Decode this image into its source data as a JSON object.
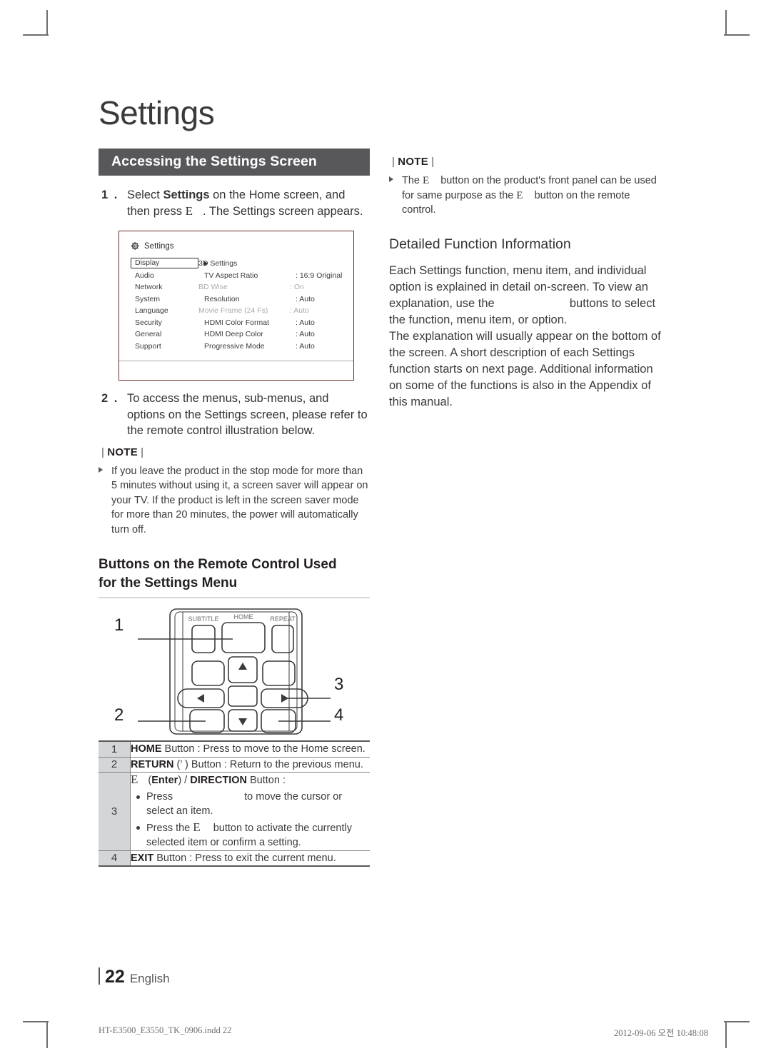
{
  "page": {
    "title": "Settings",
    "folio_number": "22",
    "folio_language": "English",
    "print_footer_left": "HT-E3500_E3550_TK_0906.indd   22",
    "print_footer_right": "2012-09-06   오전 10:48:08"
  },
  "banner": {
    "label": "Accessing the Settings Screen"
  },
  "steps": [
    {
      "number": "1 .",
      "text_a": "Select ",
      "bold": "Settings",
      "text_b": " on the Home screen, and then press ",
      "glyph": "E",
      "text_c": ". The Settings screen appears."
    },
    {
      "number": "2 .",
      "text": "To access the menus, sub-menus, and options on the Settings screen, please refer to the remote control illustration below."
    }
  ],
  "settings_mock": {
    "header": "Settings",
    "header_icon": "gear-icon",
    "selected_category": "Display",
    "categories": [
      "Display",
      "Audio",
      "Network",
      "System",
      "Language",
      "Security",
      "General",
      "Support"
    ],
    "rows": [
      {
        "item": "3D Settings",
        "separator": "",
        "value": "",
        "dim": false,
        "indent": false
      },
      {
        "item": "TV Aspect Ratio",
        "separator": ":",
        "value": "16:9 Original",
        "dim": false,
        "indent": true
      },
      {
        "item": "BD Wise",
        "separator": ":",
        "value": "On",
        "dim": true,
        "indent": false
      },
      {
        "item": "Resolution",
        "separator": ":",
        "value": "Auto",
        "dim": false,
        "indent": true
      },
      {
        "item": "Movie Frame (24 Fs)",
        "separator": ":",
        "value": "Auto",
        "dim": true,
        "indent": false
      },
      {
        "item": "HDMI Color Format",
        "separator": ":",
        "value": "Auto",
        "dim": false,
        "indent": true
      },
      {
        "item": "HDMI Deep Color",
        "separator": ":",
        "value": "Auto",
        "dim": false,
        "indent": true
      },
      {
        "item": "Progressive Mode",
        "separator": ":",
        "value": "Auto",
        "dim": false,
        "indent": true
      }
    ]
  },
  "note_left": {
    "label": "NOTE",
    "bullet": "If you leave the product in the stop mode for more than 5 minutes without using it, a screen saver will appear on your TV. If the product is left in the screen saver mode for more than 20 minutes, the power will automatically turn off."
  },
  "remote_section": {
    "heading_line1": "Buttons on the Remote Control Used",
    "heading_line2": "for the Settings Menu",
    "remote_labels": [
      "SUBTITLE",
      "HOME",
      "REPEAT"
    ],
    "callouts": [
      "1",
      "2",
      "3",
      "4"
    ]
  },
  "button_table": [
    {
      "num": "1",
      "bold": "HOME",
      "rest": " Button : Press to move to the Home screen.",
      "bullets": []
    },
    {
      "num": "2",
      "bold": "RETURN",
      "rest": " (’  ) Button : Return to the previous menu.",
      "bullets": []
    },
    {
      "num": "3",
      "glyph": "E",
      "bold_enter": "Enter",
      "bold_direction": "DIRECTION",
      "head_rest": " Button :",
      "bullets": [
        {
          "pre": "Press ",
          "post": " to move the cursor or select an item."
        },
        {
          "pre": "Press the ",
          "glyph": "E",
          "post": " button to activate the currently selected item or confirm a setting."
        }
      ]
    },
    {
      "num": "4",
      "bold": "EXIT",
      "rest": " Button : Press to exit the current menu.",
      "bullets": []
    }
  ],
  "note_right": {
    "label": "NOTE",
    "bullet_a": "The ",
    "bullet_glyph1": "E",
    "bullet_b": " button on the product's front panel can be used for same purpose as the ",
    "bullet_glyph2": "E",
    "bullet_c": " button on the remote control."
  },
  "detailed": {
    "title": "Detailed Function Information",
    "paragraph_a": "Each Settings function, menu item, and individual option is explained in detail on-screen. To view an explanation, use the ",
    "paragraph_b": " buttons to select the function, menu item, or option.",
    "paragraph_c": "The explanation will usually appear on the bottom of the screen. A short description of each Settings function starts on next page. Additional information on some of the functions is also in the Appendix of this manual."
  }
}
